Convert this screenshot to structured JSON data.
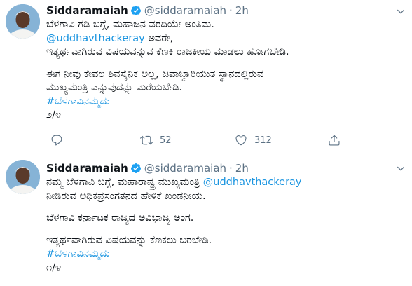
{
  "tweets": [
    {
      "name": "Siddaramaiah",
      "handle": "@siddaramaiah",
      "dot": "·",
      "time": "2h",
      "lines": [
        {
          "text": "ಬೆಳಗಾವಿ ಗಡಿ ಬಗ್ಗೆ, ಮಹಾಜನ ವರದಿಯೇ ಅಂತಿಮ.",
          "type": "text"
        },
        {
          "text": "@uddhavthackeray",
          "type": "link",
          "suffix": " ಅವರೇ,"
        },
        {
          "text": "ಇತ್ಯರ್ಥವಾಗಿರುವ ವಿಷಯವನ್ನುವ ಕೆಣಕಿ ರಾಜಕೀಯ ಮಾಡಲು ಹೋಗಬೇಡಿ.",
          "type": "text"
        },
        {
          "text": "ಈಗ ನೀವು ಕೇವಲ ಶಿವಸೈನಿಕ ಅಲ್ಲ, ಜವಾಬ್ದಾರಿಯುತ ಸ್ಥಾನದಲ್ಲಿರುವ",
          "type": "text"
        },
        {
          "text": "ಮುಖ್ಯಮಂತ್ರಿ ಎನ್ನುವುದನ್ನು ಮರೆಯಬೇಡಿ.",
          "type": "text"
        },
        {
          "text": "#ಬೆಳಗಾವಿನಮ್ಮದು",
          "type": "link"
        },
        {
          "text": "೨/೪",
          "type": "text"
        }
      ],
      "reply_count": "",
      "retweet_count": "52",
      "like_count": "312"
    },
    {
      "name": "Siddaramaiah",
      "handle": "@siddaramaiah",
      "dot": "·",
      "time": "2h",
      "lines": [
        {
          "text": "ನಮ್ಮ ಬೆಳಗಾವಿ ಬಗ್ಗೆ, ಮಹಾರಾಷ್ಟ್ರ ಮುಖ್ಯಮಂತ್ರಿ ",
          "type": "text",
          "link_suffix": "@uddhavthackeray"
        },
        {
          "text": "ನೀಡಿರುವ ಅಧಿಕಪ್ರಸಂಗತನದ ಹೇಳಿಕೆ ಖಂಡನೀಯ.",
          "type": "text"
        },
        {
          "text": "ಬೆಳಗಾವಿ ಕರ್ನಾಟಕ ರಾಜ್ಯದ ಅವಿಭಾಜ್ಯ ಅಂಗ.",
          "type": "text"
        },
        {
          "text": "ಇತ್ಯರ್ಥವಾಗಿರುವ ವಿಷಯವನ್ನು ಕೆಣಕಲು ಬರಬೇಡಿ.",
          "type": "text"
        },
        {
          "text": "#ಬೆಳಗಾವಿನಮ್ಮದು",
          "type": "link"
        },
        {
          "text": "೧/೪",
          "type": "text"
        }
      ]
    }
  ],
  "colors": {
    "link": "#1b95e0",
    "verified": "#1da1f2",
    "muted": "#5b7083",
    "divider": "#e6ecf0"
  },
  "icons": {
    "verified": "verified-badge-icon",
    "caret": "chevron-down-icon",
    "reply": "reply-icon",
    "retweet": "retweet-icon",
    "like": "heart-icon",
    "share": "share-icon"
  }
}
